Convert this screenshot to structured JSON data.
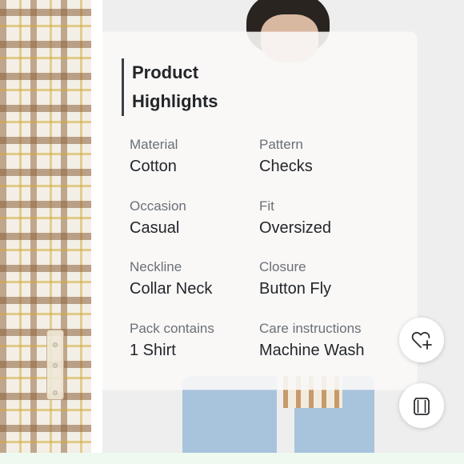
{
  "highlights": {
    "title_line1": "Product",
    "title_line2": "Highlights",
    "attributes": [
      {
        "label": "Material",
        "value": "Cotton"
      },
      {
        "label": "Pattern",
        "value": "Checks"
      },
      {
        "label": "Occasion",
        "value": "Casual"
      },
      {
        "label": "Fit",
        "value": "Oversized"
      },
      {
        "label": "Neckline",
        "value": "Collar Neck"
      },
      {
        "label": "Closure",
        "value": "Button Fly"
      },
      {
        "label": "Pack contains",
        "value": "1 Shirt"
      },
      {
        "label": "Care instructions",
        "value": "Machine Wash"
      }
    ]
  },
  "actions": {
    "wishlist_icon": "heart-plus-icon",
    "wardrobe_icon": "wardrobe-icon"
  },
  "colors": {
    "text_primary": "#24262b",
    "text_secondary": "#6b6f76",
    "title_bar": "#3d4048",
    "bottom_strip": "#eefaf0"
  }
}
